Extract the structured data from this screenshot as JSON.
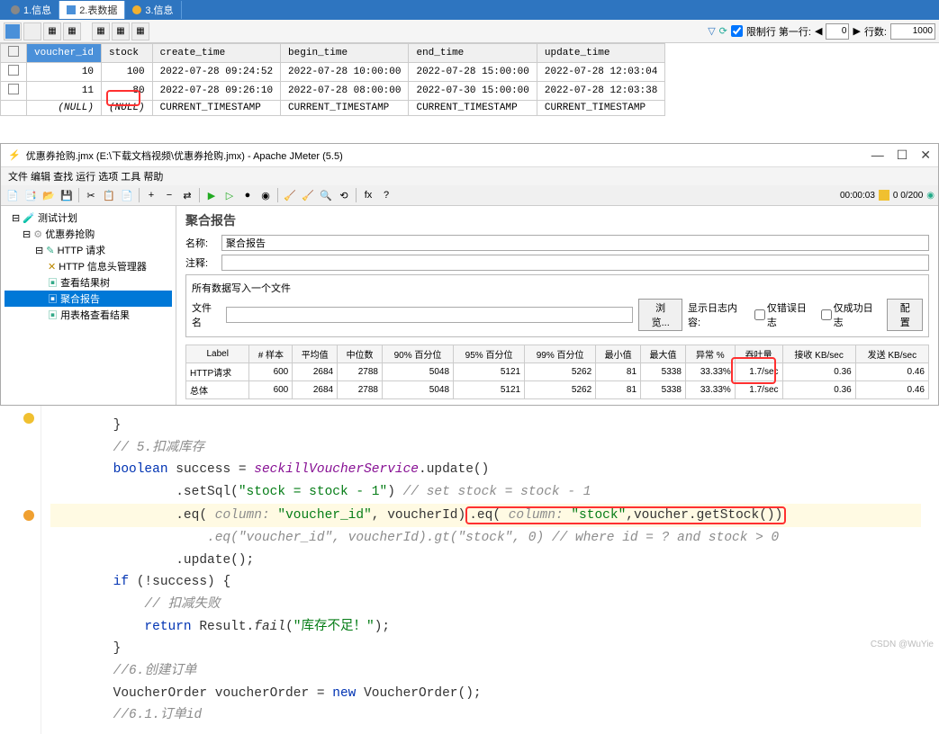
{
  "top_tabs": [
    "1.信息",
    "2.表数据",
    "3.信息"
  ],
  "active_top_tab": 1,
  "right_tb": {
    "limit_label": "限制行 第一行:",
    "first": "0",
    "rows_label": "行数:",
    "rows": "1000"
  },
  "grid": {
    "cols": [
      "voucher_id",
      "stock",
      "create_time",
      "begin_time",
      "end_time",
      "update_time"
    ],
    "rows": [
      {
        "chk": false,
        "cells": [
          "10",
          "100",
          "2022-07-28 09:24:52",
          "2022-07-28 10:00:00",
          "2022-07-28 15:00:00",
          "2022-07-28 12:03:04"
        ]
      },
      {
        "chk": false,
        "cells": [
          "11",
          "80",
          "2022-07-28 09:26:10",
          "2022-07-28 08:00:00",
          "2022-07-30 15:00:00",
          "2022-07-28 12:03:38"
        ]
      },
      {
        "chk": false,
        "cells": [
          "(NULL)",
          "(NULL)",
          "CURRENT_TIMESTAMP",
          "CURRENT_TIMESTAMP",
          "CURRENT_TIMESTAMP",
          "CURRENT_TIMESTAMP"
        ]
      }
    ]
  },
  "jm": {
    "title": "优惠券抢购.jmx (E:\\下载文档视频\\优惠券抢购.jmx) - Apache JMeter (5.5)",
    "menu": "文件 编辑 查找 运行 选项 工具 帮助",
    "timer": "00:00:03",
    "count": "0 0/200"
  },
  "tree": {
    "root": "测试计划",
    "n1": "优惠券抢购",
    "n2": "HTTP 请求",
    "n3": "HTTP 信息头管理器",
    "n4": "查看结果树",
    "n5": "聚合报告",
    "n6": "用表格查看结果"
  },
  "report": {
    "heading": "聚合报告",
    "name_lbl": "名称:",
    "name_val": "聚合报告",
    "comment_lbl": "注释:",
    "group": "所有数据写入一个文件",
    "file_lbl": "文件名",
    "browse": "浏览...",
    "log_lbl": "显示日志内容:",
    "err_only": "仅错误日志",
    "succ_only": "仅成功日志",
    "config": "配置"
  },
  "agg": {
    "cols": [
      "Label",
      "# 样本",
      "平均值",
      "中位数",
      "90% 百分位",
      "95% 百分位",
      "99% 百分位",
      "最小值",
      "最大值",
      "异常 %",
      "吞吐量",
      "接收 KB/sec",
      "发送 KB/sec"
    ],
    "rows": [
      [
        "HTTP请求",
        "600",
        "2684",
        "2788",
        "5048",
        "5121",
        "5262",
        "81",
        "5338",
        "33.33%",
        "1.7/sec",
        "0.36",
        "0.46"
      ],
      [
        "总体",
        "600",
        "2684",
        "2788",
        "5048",
        "5121",
        "5262",
        "81",
        "5338",
        "33.33%",
        "1.7/sec",
        "0.36",
        "0.46"
      ]
    ]
  },
  "code": {
    "c1": "}",
    "c2": "// 5.扣减库存",
    "c3a": "boolean",
    "c3b": " success = ",
    "c3c": "seckillVoucherService",
    "c3d": ".update()",
    "c4a": ".setSql(",
    "c4b": "\"stock = stock - 1\"",
    "c4c": ") ",
    "c4d": "// set stock = stock - 1",
    "c5a": ".eq( ",
    "c5p1": "column:",
    "c5b": " \"voucher_id\"",
    "c5c": ", voucherId)",
    "c5d": ".eq( ",
    "c5p2": "column:",
    "c5e": " \"stock\"",
    "c5f": ",voucher.getStock())",
    "c6": ".eq(\"voucher_id\", voucherId).gt(\"stock\", 0) // where id = ? and stock > 0",
    "c7": ".update();",
    "c8a": "if",
    "c8b": " (!success) {",
    "c9": "// 扣减失败",
    "c10a": "return",
    "c10b": " Result.",
    "c10c": "fail",
    "c10d": "(",
    "c10e": "\"库存不足！\"",
    "c10f": ");",
    "c11": "}",
    "c12": "//6.创建订单",
    "c13a": "VoucherOrder voucherOrder = ",
    "c13b": "new",
    "c13c": " VoucherOrder();",
    "c14": "//6.1.订单id"
  },
  "watermark": "CSDN @WuYie"
}
